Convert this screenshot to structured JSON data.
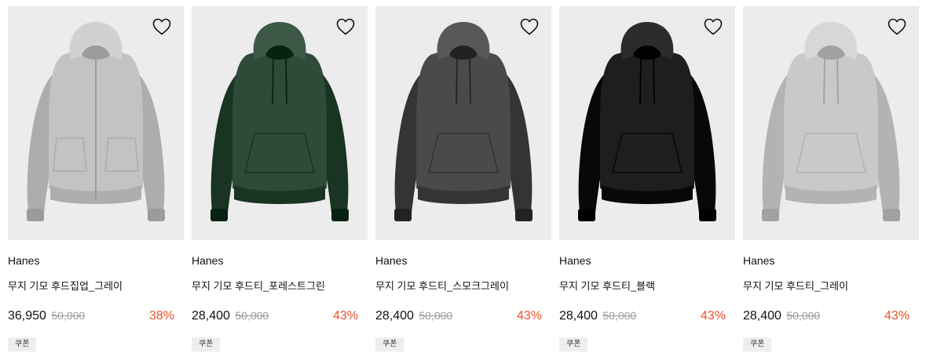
{
  "products": [
    {
      "brand": "Hanes",
      "name": "무지 기모 후드집업_그레이",
      "price": "36,950",
      "original_price": "50,000",
      "discount": "38%",
      "badge": "쿠폰",
      "wishlist_icon": "heart-outline-icon",
      "image_color": "#c3c3c3",
      "image_style": "zip-hoodie"
    },
    {
      "brand": "Hanes",
      "name": "무지 기모 후드티_포레스트그린",
      "price": "28,400",
      "original_price": "50,000",
      "discount": "43%",
      "badge": "쿠폰",
      "wishlist_icon": "heart-outline-icon",
      "image_color": "#2f4a38",
      "image_style": "pullover-hoodie"
    },
    {
      "brand": "Hanes",
      "name": "무지 기모 후드티_스모크그레이",
      "price": "28,400",
      "original_price": "50,000",
      "discount": "43%",
      "badge": "쿠폰",
      "wishlist_icon": "heart-outline-icon",
      "image_color": "#4a4a4c",
      "image_style": "pullover-hoodie"
    },
    {
      "brand": "Hanes",
      "name": "무지 기모 후드티_블랙",
      "price": "28,400",
      "original_price": "50,000",
      "discount": "43%",
      "badge": "쿠폰",
      "wishlist_icon": "heart-outline-icon",
      "image_color": "#1e1e20",
      "image_style": "pullover-hoodie"
    },
    {
      "brand": "Hanes",
      "name": "무지 기모 후드티_그레이",
      "price": "28,400",
      "original_price": "50,000",
      "discount": "43%",
      "badge": "쿠폰",
      "wishlist_icon": "heart-outline-icon",
      "image_color": "#c9c9c9",
      "image_style": "pullover-hoodie"
    }
  ],
  "colors": {
    "discount": "#e8502a",
    "thumbnail_bg": "#ececec",
    "original_price": "#9a9a9a"
  }
}
